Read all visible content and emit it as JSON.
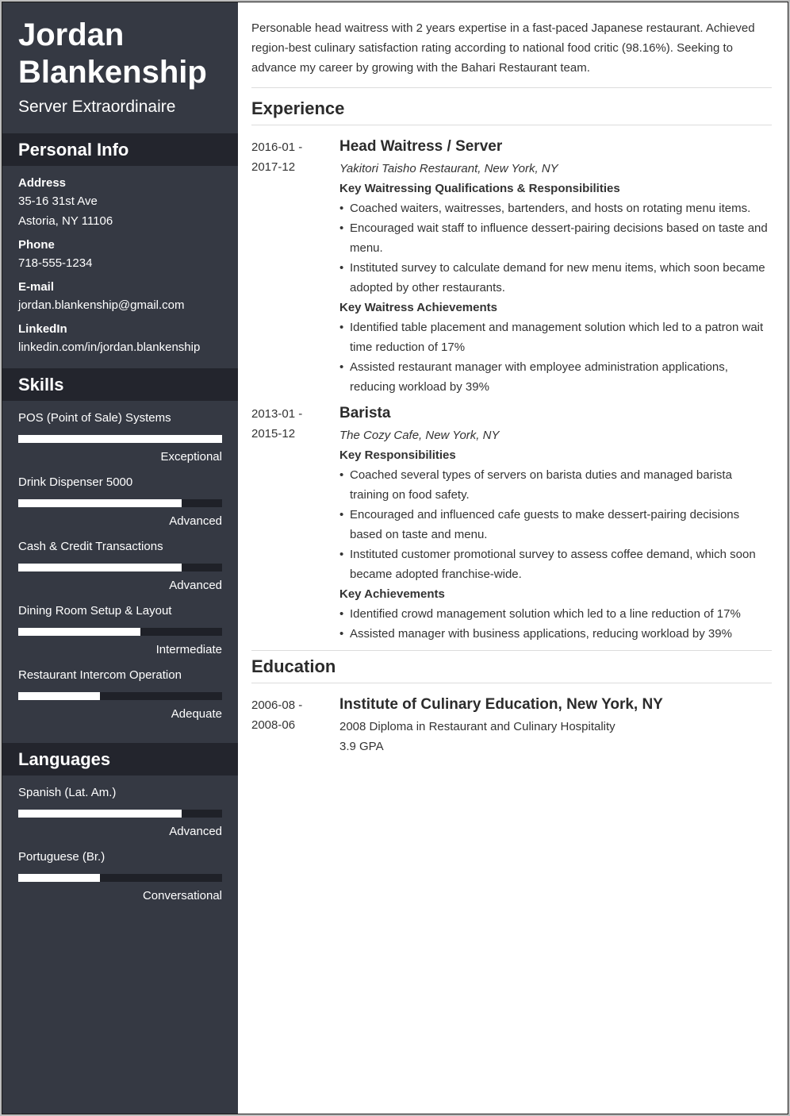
{
  "header": {
    "name_line1": "Jordan",
    "name_line2": "Blankenship",
    "role": "Server Extraordinaire"
  },
  "personal_info": {
    "title": "Personal Info",
    "fields": [
      {
        "label": "Address",
        "lines": [
          "35-16 31st Ave",
          "Astoria, NY 11106"
        ]
      },
      {
        "label": "Phone",
        "lines": [
          "718-555-1234"
        ]
      },
      {
        "label": "E-mail",
        "lines": [
          "jordan.blankenship@gmail.com"
        ]
      },
      {
        "label": "LinkedIn",
        "lines": [
          "linkedin.com/in/jordan.blankenship"
        ]
      }
    ]
  },
  "skills": {
    "title": "Skills",
    "items": [
      {
        "name": "POS (Point of Sale) Systems",
        "level": "Exceptional",
        "fraction": 1.0
      },
      {
        "name": "Drink Dispenser 5000",
        "level": "Advanced",
        "fraction": 0.8
      },
      {
        "name": "Cash & Credit Transactions",
        "level": "Advanced",
        "fraction": 0.8
      },
      {
        "name": "Dining Room Setup & Layout",
        "level": "Intermediate",
        "fraction": 0.6
      },
      {
        "name": "Restaurant Intercom Operation",
        "level": "Adequate",
        "fraction": 0.4
      }
    ]
  },
  "languages": {
    "title": "Languages",
    "items": [
      {
        "name": "Spanish (Lat. Am.)",
        "level": "Advanced",
        "fraction": 0.8
      },
      {
        "name": "Portuguese (Br.)",
        "level": "Conversational",
        "fraction": 0.4
      }
    ]
  },
  "summary": "Personable head waitress with 2 years expertise in a fast-paced Japanese restaurant. Achieved region-best culinary satisfaction rating according to national food critic (98.16%). Seeking to advance my career by growing with the Bahari Restaurant team.",
  "experience": {
    "title": "Experience",
    "entries": [
      {
        "date_start": "2016-01 -",
        "date_end": "2017-12",
        "title": "Head Waitress / Server",
        "company": "Yakitori Taisho Restaurant, New York, NY",
        "groups": [
          {
            "heading": "Key Waitressing Qualifications & Responsibilities",
            "bullets": [
              "Coached waiters, waitresses, bartenders, and hosts on rotating menu items.",
              "Encouraged wait staff to influence dessert-pairing decisions based on taste and menu.",
              "Instituted survey to calculate demand for new menu items, which soon became adopted by other restaurants."
            ]
          },
          {
            "heading": "Key Waitress Achievements",
            "bullets": [
              "Identified table placement and management solution which led to a patron wait time reduction of 17%",
              "Assisted restaurant manager with employee administration applications, reducing workload by 39%"
            ]
          }
        ]
      },
      {
        "date_start": "2013-01 -",
        "date_end": "2015-12",
        "title": "Barista",
        "company": "The Cozy Cafe, New York, NY",
        "groups": [
          {
            "heading": "Key Responsibilities",
            "bullets": [
              "Coached several types of servers on barista duties and managed barista training on food safety.",
              "Encouraged and influenced cafe guests to make dessert-pairing decisions based on taste and menu.",
              "Instituted customer promotional survey to assess coffee demand, which soon became adopted franchise-wide."
            ]
          },
          {
            "heading": "Key Achievements",
            "bullets": [
              "Identified crowd management solution which led to a line reduction of 17%",
              "Assisted manager with business applications, reducing workload by 39%"
            ]
          }
        ]
      }
    ]
  },
  "education": {
    "title": "Education",
    "entries": [
      {
        "date_start": "2006-08 -",
        "date_end": "2008-06",
        "title": "Institute of Culinary Education, New York, NY",
        "lines": [
          "2008 Diploma in Restaurant and Culinary Hospitality",
          "3.9 GPA"
        ]
      }
    ]
  }
}
